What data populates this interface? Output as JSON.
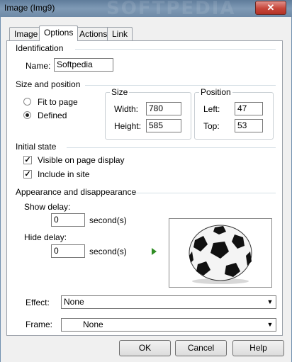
{
  "window": {
    "title": "Image (Img9)",
    "watermark": "SOFTPEDIA",
    "close_glyph": "✕"
  },
  "tabs": [
    {
      "label": "Image",
      "active": false
    },
    {
      "label": "Options",
      "active": true
    },
    {
      "label": "Actions",
      "active": false
    },
    {
      "label": "Link",
      "active": false
    }
  ],
  "identification": {
    "section_title": "Identification",
    "name_label": "Name:",
    "name_value": "Softpedia"
  },
  "size_position": {
    "section_title": "Size and position",
    "fit_to_page_label": "Fit to page",
    "defined_label": "Defined",
    "selected": "Defined",
    "size_group_title": "Size",
    "width_label": "Width:",
    "width_value": "780",
    "height_label": "Height:",
    "height_value": "585",
    "position_group_title": "Position",
    "left_label": "Left:",
    "left_value": "47",
    "top_label": "Top:",
    "top_value": "53"
  },
  "initial_state": {
    "section_title": "Initial state",
    "visible_label": "Visible on page display",
    "visible_checked": true,
    "include_label": "Include in site",
    "include_checked": true
  },
  "appearance": {
    "section_title": "Appearance and disappearance",
    "show_delay_label": "Show delay:",
    "show_delay_value": "0",
    "show_delay_unit": "second(s)",
    "hide_delay_label": "Hide delay:",
    "hide_delay_value": "0",
    "hide_delay_unit": "second(s)",
    "effect_label": "Effect:",
    "effect_value": "None",
    "frame_label": "Frame:",
    "frame_value": "None"
  },
  "buttons": {
    "ok": "OK",
    "cancel": "Cancel",
    "help": "Help"
  },
  "colors": {
    "title_bar": "#6f8fae",
    "close_button": "#c7463a",
    "play_arrow": "#2f8d24"
  }
}
